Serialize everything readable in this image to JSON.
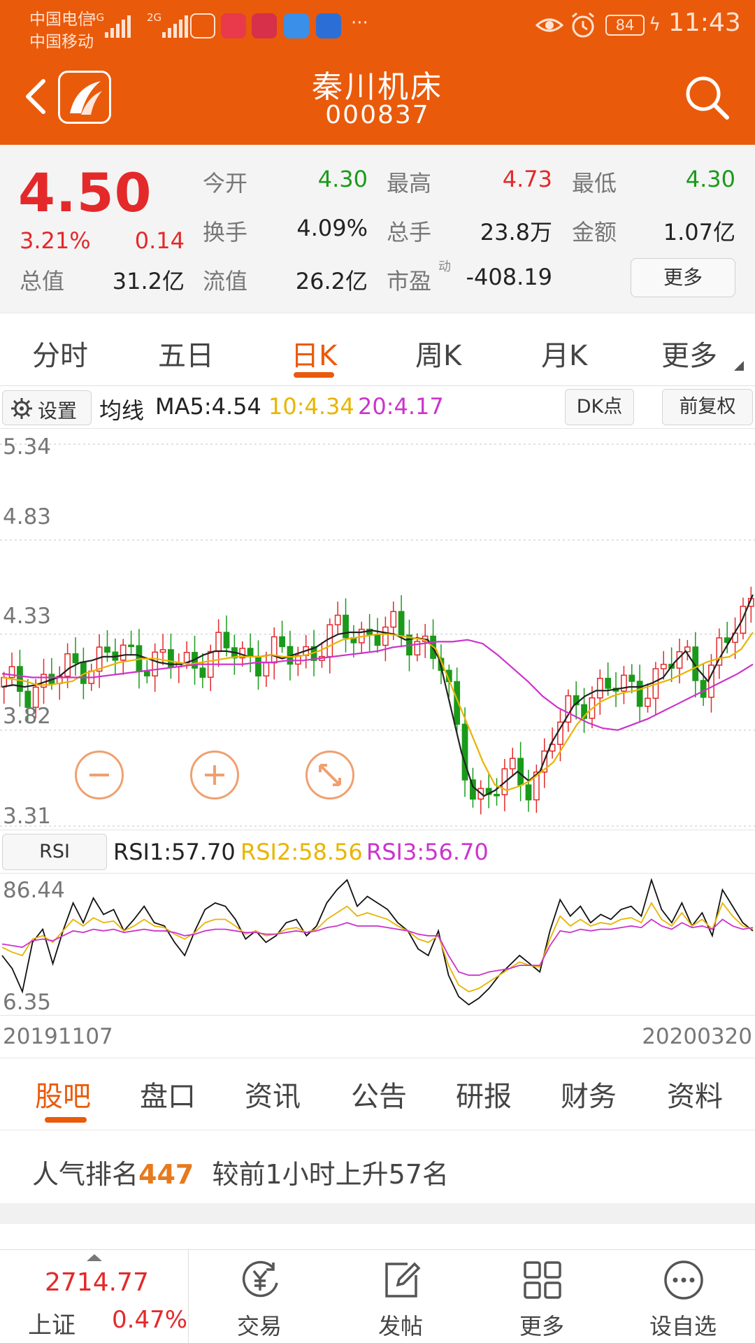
{
  "status_bar": {
    "carrier1": "中国电信",
    "carrier2": "中国移动",
    "net1": "4G",
    "net2": "2G",
    "battery": "84",
    "time": "11:43"
  },
  "header": {
    "stock_name": "秦川机床",
    "stock_code": "000837"
  },
  "quote": {
    "price": "4.50",
    "change_pct": "3.21%",
    "change_abs": "0.14",
    "fields": [
      {
        "label": "今开",
        "value": "4.30",
        "color": "green"
      },
      {
        "label": "最高",
        "value": "4.73",
        "color": "red"
      },
      {
        "label": "最低",
        "value": "4.30",
        "color": "green"
      },
      {
        "label": "换手",
        "value": "4.09%",
        "color": "plain"
      },
      {
        "label": "总手",
        "value": "23.8万",
        "color": "plain"
      },
      {
        "label": "金额",
        "value": "1.07亿",
        "color": "plain"
      },
      {
        "label": "总值",
        "value": "31.2亿",
        "color": "plain"
      },
      {
        "label": "流值",
        "value": "26.2亿",
        "color": "plain"
      },
      {
        "label": "市盈",
        "value": "-408.19",
        "color": "plain"
      }
    ],
    "pe_superscript": "动",
    "more_label": "更多"
  },
  "period_tabs": [
    "分时",
    "五日",
    "日K",
    "周K",
    "月K",
    "更多"
  ],
  "active_period": 2,
  "ma_bar": {
    "settings_label": "设置",
    "title": "均线",
    "ma5": "MA5:4.54",
    "ma10": "10:4.34",
    "ma20": "20:4.17",
    "dk_label": "DK点",
    "adjust_label": "前复权"
  },
  "kline_axis": [
    "5.34",
    "4.83",
    "4.33",
    "3.82",
    "3.31"
  ],
  "rsi_bar": {
    "button_label": "RSI",
    "rsi1": "RSI1:57.70",
    "rsi2": "RSI2:58.56",
    "rsi3": "RSI3:56.70"
  },
  "rsi_axis": [
    "86.44",
    "6.35"
  ],
  "dates": {
    "start": "20191107",
    "end": "20200320"
  },
  "section_tabs": [
    "股吧",
    "盘口",
    "资讯",
    "公告",
    "研报",
    "财务",
    "资料"
  ],
  "active_section": 0,
  "popularity": {
    "prefix": "人气排名",
    "rank": "447",
    "suffix": "较前1小时上升57名"
  },
  "bottom_nav": {
    "index_value": "2714.77",
    "index_name": "上证",
    "index_pct": "0.47%",
    "items": [
      "交易",
      "发帖",
      "更多",
      "设自选"
    ]
  },
  "colors": {
    "brand": "#ea5a0b",
    "up": "#e4292a",
    "down": "#1a9a1a",
    "ma5": "#222222",
    "ma10": "#e9b400",
    "ma20": "#cc33cc"
  },
  "chart_data": [
    {
      "type": "candlestick",
      "ylim": [
        3.31,
        5.34
      ],
      "series": [
        {
          "name": "MA5",
          "values": [
            4.05,
            4.06,
            4.05,
            4.06,
            4.08,
            4.1,
            4.15,
            4.18,
            4.19,
            4.21,
            4.21,
            4.22,
            4.22,
            4.2,
            4.18,
            4.17,
            4.17,
            4.19,
            4.22,
            4.24,
            4.24,
            4.23,
            4.21,
            4.21,
            4.22,
            4.2,
            4.22,
            4.24,
            4.26,
            4.3,
            4.33,
            4.34,
            4.34,
            4.35,
            4.34,
            4.33,
            4.3,
            4.31,
            4.3,
            4.2,
            3.95,
            3.7,
            3.52,
            3.47,
            3.5,
            3.55,
            3.6,
            3.55,
            3.6,
            3.75,
            3.85,
            3.95,
            4.0,
            4.03,
            4.03,
            4.04,
            4.05,
            4.05,
            4.07,
            4.1,
            4.18,
            4.24,
            4.15,
            4.08,
            4.2,
            4.3,
            4.4,
            4.54
          ]
        },
        {
          "name": "10",
          "values": [
            4.1,
            4.09,
            4.08,
            4.06,
            4.06,
            4.07,
            4.08,
            4.12,
            4.14,
            4.16,
            4.18,
            4.19,
            4.2,
            4.2,
            4.19,
            4.18,
            4.17,
            4.18,
            4.19,
            4.2,
            4.21,
            4.21,
            4.21,
            4.22,
            4.21,
            4.21,
            4.22,
            4.24,
            4.27,
            4.3,
            4.31,
            4.32,
            4.33,
            4.33,
            4.32,
            4.31,
            4.3,
            4.25,
            4.1,
            3.95,
            3.8,
            3.65,
            3.53,
            3.5,
            3.52,
            3.55,
            3.6,
            3.65,
            3.75,
            3.85,
            3.92,
            3.97,
            4.0,
            4.02,
            4.03,
            4.05,
            4.07,
            4.09,
            4.12,
            4.15,
            4.18,
            4.2,
            4.21,
            4.25,
            4.34
          ]
        },
        {
          "name": "20",
          "values": [
            4.12,
            4.11,
            4.1,
            4.1,
            4.1,
            4.1,
            4.1,
            4.11,
            4.12,
            4.13,
            4.14,
            4.15,
            4.16,
            4.17,
            4.17,
            4.17,
            4.17,
            4.18,
            4.18,
            4.19,
            4.19,
            4.2,
            4.21,
            4.22,
            4.23,
            4.24,
            4.26,
            4.27,
            4.28,
            4.29,
            4.29,
            4.3,
            4.28,
            4.22,
            4.15,
            4.08,
            4.0,
            3.94,
            3.9,
            3.86,
            3.83,
            3.82,
            3.85,
            3.88,
            3.92,
            3.96,
            4.0,
            4.04,
            4.08,
            4.12,
            4.17
          ]
        }
      ]
    },
    {
      "type": "line",
      "ylim": [
        6.35,
        86.44
      ],
      "series": [
        {
          "name": "RSI1",
          "values": [
            40,
            32,
            18,
            48,
            56,
            35,
            55,
            72,
            60,
            75,
            65,
            68,
            55,
            62,
            70,
            60,
            58,
            48,
            40,
            55,
            68,
            72,
            70,
            62,
            50,
            55,
            48,
            52,
            60,
            62,
            52,
            58,
            72,
            80,
            86,
            70,
            76,
            72,
            68,
            60,
            55,
            44,
            40,
            55,
            28,
            15,
            10,
            14,
            20,
            28,
            34,
            40,
            35,
            30,
            55,
            74,
            64,
            70,
            60,
            65,
            62,
            68,
            70,
            64,
            86,
            68,
            60,
            72,
            58,
            66,
            52,
            80,
            70,
            60,
            55
          ]
        },
        {
          "name": "RSI2",
          "values": [
            45,
            42,
            40,
            50,
            52,
            48,
            55,
            62,
            58,
            63,
            60,
            61,
            55,
            58,
            62,
            58,
            57,
            53,
            50,
            54,
            60,
            62,
            62,
            58,
            53,
            55,
            52,
            53,
            56,
            57,
            54,
            56,
            62,
            66,
            70,
            64,
            66,
            64,
            62,
            58,
            55,
            50,
            48,
            52,
            34,
            22,
            18,
            20,
            24,
            28,
            32,
            36,
            34,
            33,
            50,
            64,
            58,
            62,
            58,
            60,
            59,
            62,
            63,
            60,
            72,
            62,
            58,
            66,
            58,
            62,
            56,
            72,
            64,
            58,
            56
          ]
        },
        {
          "name": "RSI3",
          "values": [
            47,
            46,
            45,
            49,
            50,
            49,
            52,
            55,
            54,
            56,
            55,
            56,
            54,
            55,
            56,
            55,
            55,
            54,
            52,
            53,
            55,
            56,
            56,
            55,
            54,
            54,
            53,
            53,
            54,
            55,
            54,
            55,
            57,
            58,
            60,
            58,
            58,
            58,
            57,
            56,
            55,
            53,
            52,
            52,
            40,
            30,
            28,
            28,
            30,
            31,
            32,
            34,
            34,
            34,
            46,
            55,
            54,
            56,
            55,
            56,
            56,
            57,
            58,
            57,
            62,
            58,
            56,
            60,
            57,
            58,
            56,
            62,
            58,
            56,
            57
          ]
        }
      ]
    }
  ]
}
